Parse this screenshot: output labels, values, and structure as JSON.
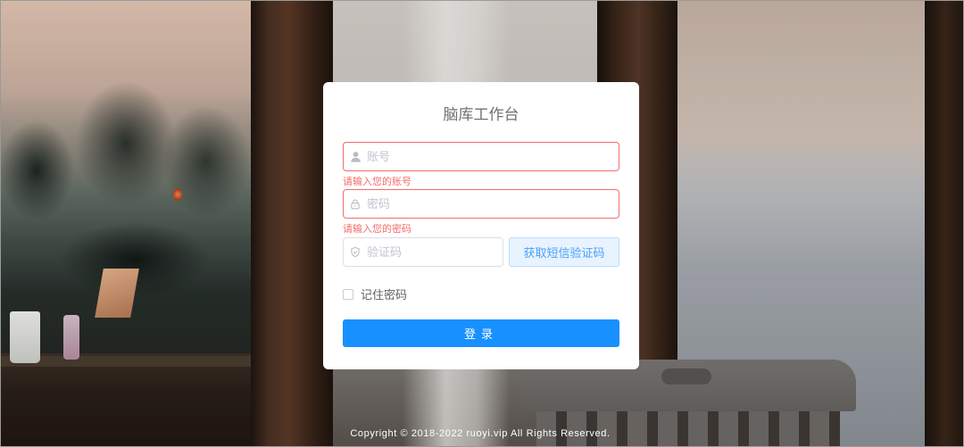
{
  "login": {
    "title": "脑库工作台",
    "username": {
      "placeholder": "账号",
      "value": "",
      "error": "请输入您的账号",
      "icon": "user-icon"
    },
    "password": {
      "placeholder": "密码",
      "value": "",
      "error": "请输入您的密码",
      "icon": "lock-icon"
    },
    "sms_code": {
      "placeholder": "验证码",
      "value": "",
      "icon": "shield-icon",
      "button_label": "获取短信验证码"
    },
    "remember_label": "记住密码",
    "remember_checked": false,
    "submit_label": "登录"
  },
  "footer": {
    "copyright": "Copyright © 2018-2022 ruoyi.vip All Rights Reserved."
  },
  "colors": {
    "primary": "#1890ff",
    "error": "#f56c6c",
    "code_button_bg": "#e8f3ff",
    "code_button_text": "#4aa3f5"
  }
}
